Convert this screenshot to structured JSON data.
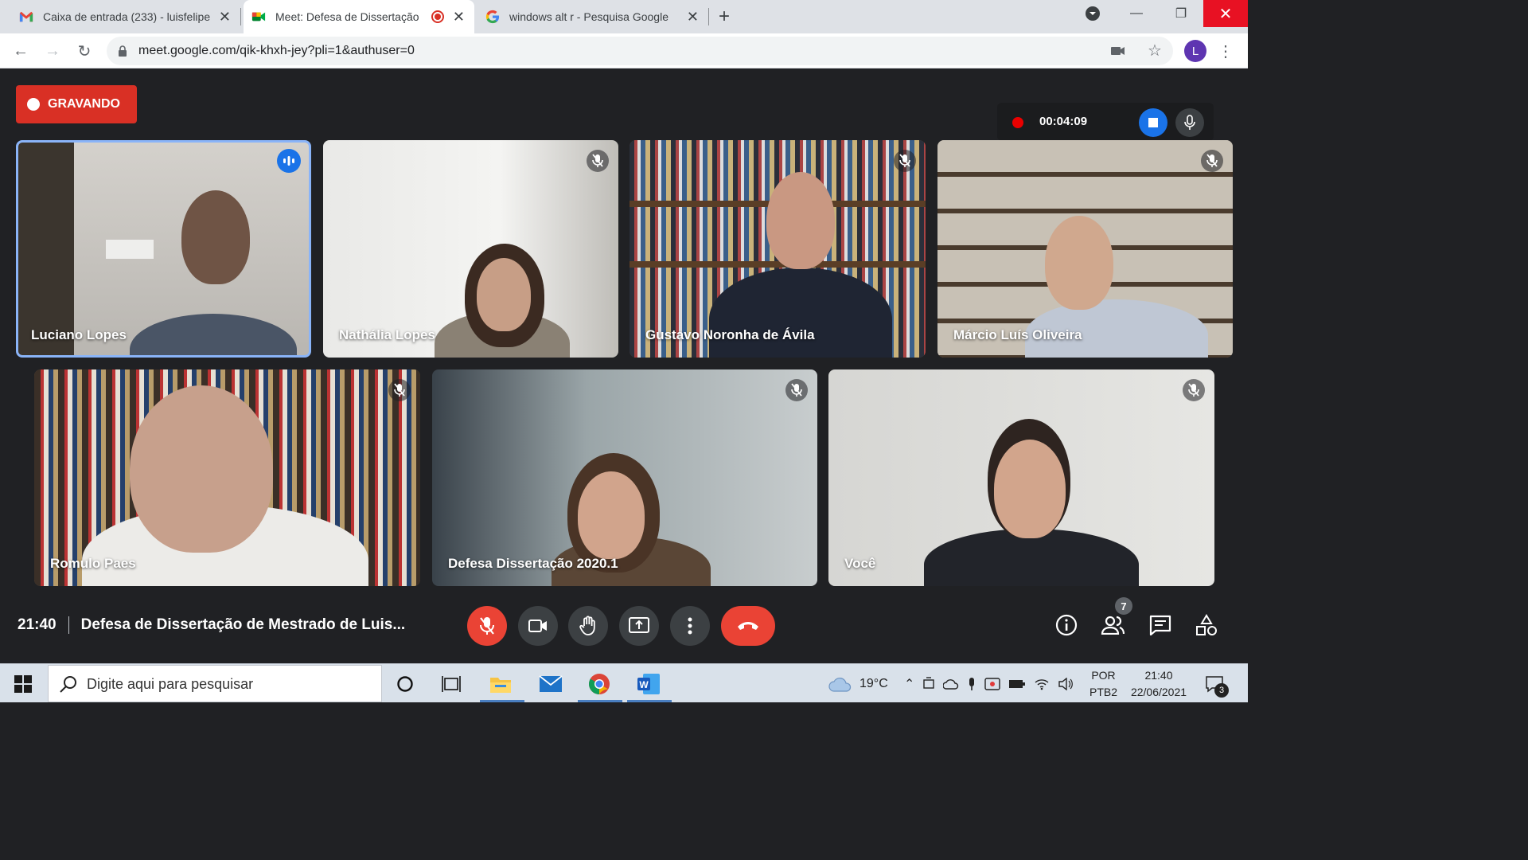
{
  "browser": {
    "tabs": [
      {
        "title": "Caixa de entrada (233) - luisfelipe",
        "icon": "gmail-icon"
      },
      {
        "title": "Meet: Defesa de Dissertação",
        "icon": "meet-icon",
        "recording": true
      },
      {
        "title": "windows alt r - Pesquisa Google",
        "icon": "google-icon"
      }
    ],
    "url": "meet.google.com/qik-khxh-jey?pli=1&authuser=0",
    "profile_initial": "L"
  },
  "meet": {
    "recording_label": "GRAVANDO",
    "recording_timer": "00:04:09",
    "participants": [
      {
        "name": "Luciano Lopes",
        "speaking": true
      },
      {
        "name": "Nathália Lopes",
        "muted": true
      },
      {
        "name": "Gustavo Noronha de Ávila",
        "muted": true
      },
      {
        "name": "Márcio Luís Oliveira",
        "muted": true
      },
      {
        "name": "Romulo Paes",
        "muted": true
      },
      {
        "name": "Defesa Dissertação 2020.1",
        "muted": true
      },
      {
        "name": "Você",
        "muted": true
      }
    ],
    "time": "21:40",
    "meeting_title": "Defesa de Dissertação de Mestrado de Luis...",
    "people_count": "7"
  },
  "taskbar": {
    "search_placeholder": "Digite aqui para pesquisar",
    "weather": "19°C",
    "lang_top": "POR",
    "lang_bottom": "PTB2",
    "clock_time": "21:40",
    "clock_date": "22/06/2021",
    "notif_count": "3"
  },
  "colors": {
    "accent_red": "#ea4335",
    "speaking_border": "#8ab4f8",
    "meet_bg": "#202124"
  }
}
